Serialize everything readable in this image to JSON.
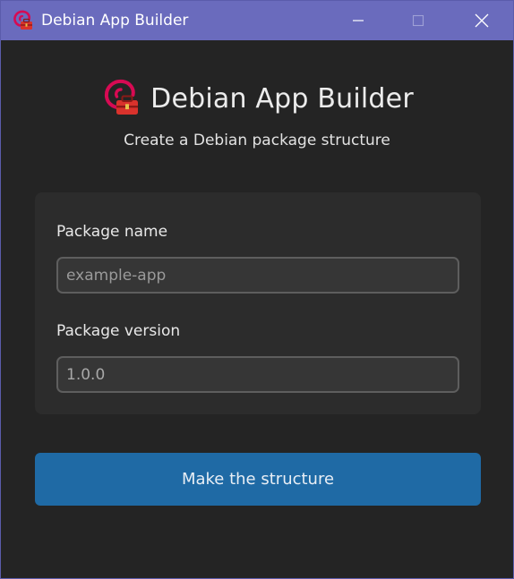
{
  "window": {
    "title": "Debian App Builder",
    "titlebar_color": "#6a6bbd",
    "controls": {
      "minimize_icon": "minimize-icon",
      "maximize_icon": "maximize-icon",
      "close_icon": "close-icon"
    }
  },
  "header": {
    "title": "Debian App Builder",
    "subtitle": "Create a Debian package structure",
    "icon": "debian-toolbox-icon"
  },
  "form": {
    "package_name": {
      "label": "Package name",
      "placeholder": "example-app",
      "value": ""
    },
    "package_version": {
      "label": "Package version",
      "placeholder": "",
      "value": "1.0.0"
    }
  },
  "actions": {
    "make_structure_label": "Make the structure"
  },
  "colors": {
    "background": "#242424",
    "card": "#2c2c2c",
    "accent_button": "#1f6aa5",
    "debian_red": "#d70a53",
    "toolbox_red": "#d9322c"
  }
}
